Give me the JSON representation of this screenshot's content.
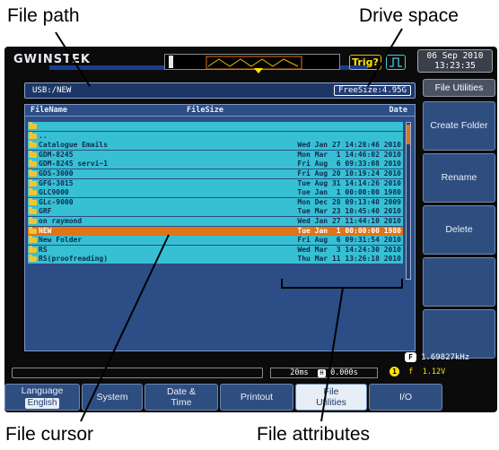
{
  "callouts": {
    "file_path": "File path",
    "drive_space": "Drive space",
    "file_cursor": "File cursor",
    "file_attributes": "File attributes"
  },
  "topbar": {
    "logo": "GWINSTEK",
    "trigger_label": "Trig?",
    "date_line1": "06 Sep 2010",
    "date_line2": "13:23:35"
  },
  "path": {
    "current": "USB:/NEW",
    "free_size": "FreeSize:4.95G"
  },
  "file_table": {
    "columns": [
      "FileName",
      "FileSize",
      "Date"
    ],
    "rows": [
      {
        "name": "",
        "date": "",
        "selected": false
      },
      {
        "name": "..",
        "date": "",
        "selected": false
      },
      {
        "name": "Catalogue Emails",
        "date": "Wed Jan 27 14:28:46 2010",
        "selected": false
      },
      {
        "name": "GDM-8245",
        "date": "Mon Mar  1 14:46:02 2010",
        "selected": false
      },
      {
        "name": "GDM-8245 servi~1",
        "date": "Fri Aug  6 09:33:08 2010",
        "selected": false
      },
      {
        "name": "GDS-3000",
        "date": "Fri Aug 20 10:19:24 2010",
        "selected": false
      },
      {
        "name": "GFG-3015",
        "date": "Tue Aug 31 14:14:26 2010",
        "selected": false
      },
      {
        "name": "GLC9000",
        "date": "Tue Jan  1 00:00:00 1980",
        "selected": false
      },
      {
        "name": "GLc-9000",
        "date": "Mon Dec 28 09:13:40 2009",
        "selected": false
      },
      {
        "name": "GRF",
        "date": "Tue Mar 23 10:45:40 2010",
        "selected": false
      },
      {
        "name": "on raymond",
        "date": "Wed Jan 27 11:44:10 2010",
        "selected": false
      },
      {
        "name": "NEW",
        "date": "Tue Jan  1 00:00:00 1980",
        "selected": true
      },
      {
        "name": "New Folder",
        "date": "Fri Aug  6 09:31:54 2010",
        "selected": false
      },
      {
        "name": "RS",
        "date": "Wed Mar  3 14:24:30 2010",
        "selected": false
      },
      {
        "name": "RS(proofreading)",
        "date": "Thu Mar 11 13:26:18 2010",
        "selected": false
      }
    ]
  },
  "side_menu": {
    "title": "File Utilities",
    "buttons": [
      "Create Folder",
      "Rename",
      "Delete",
      "",
      ""
    ]
  },
  "status": {
    "frequency": "1.69827kHz",
    "freq_badge": "F",
    "timebase": "20ms",
    "offset_badge": "H",
    "offset": "0.000s",
    "trigger_level": "1.12V",
    "trigger_channel": "1",
    "trigger_slope": "f"
  },
  "bottom_menu": {
    "language_label": "Language",
    "language_value": "English",
    "system": "System",
    "date_time": "Date & Time",
    "printout": "Printout",
    "file_utilities": "File Utilities",
    "io": "I/O"
  }
}
